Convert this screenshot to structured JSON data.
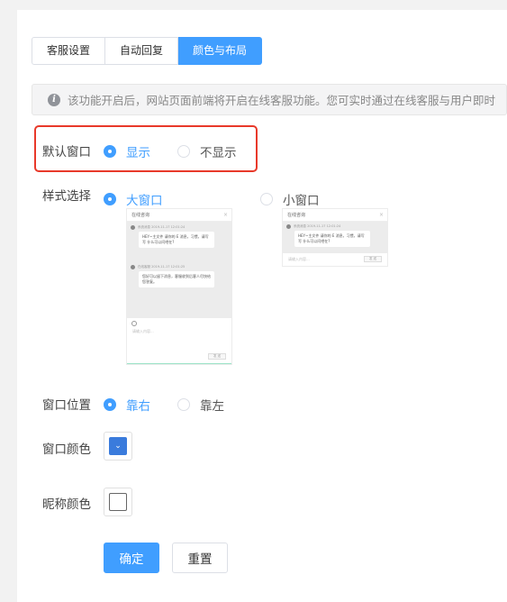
{
  "tabs": [
    {
      "label": "客服设置",
      "active": false
    },
    {
      "label": "自动回复",
      "active": false
    },
    {
      "label": "颜色与布局",
      "active": true
    }
  ],
  "info": {
    "icon": "info-icon",
    "text": "该功能开启后，网站页面前端将开启在线客服功能。您可实时通过在线客服与用户即时"
  },
  "default_window": {
    "label": "默认窗口",
    "options": [
      {
        "label": "显示",
        "checked": true
      },
      {
        "label": "不显示",
        "checked": false
      }
    ]
  },
  "style": {
    "label": "样式选择",
    "options": [
      {
        "label": "大窗口",
        "checked": true
      },
      {
        "label": "小窗口",
        "checked": false
      }
    ],
    "preview": {
      "title": "在线咨询",
      "close": "×",
      "msg1_meta": "系统消息 2019-11-17 12:01:24",
      "msg1_text": "HEY~主文件 请你的 E 消息，习惯，请写写 什么可以问吧在?",
      "msg2_meta": "在线客服 2019-11-17 12:01:25",
      "msg2_text": "您好可以留下消息，客服收到后客人尽快给您答复。",
      "placeholder": "请输入内容...",
      "send": "发 送"
    }
  },
  "position": {
    "label": "窗口位置",
    "options": [
      {
        "label": "靠右",
        "checked": true
      },
      {
        "label": "靠左",
        "checked": false
      }
    ]
  },
  "window_color": {
    "label": "窗口颜色",
    "value": "#3a7bdc"
  },
  "nickname_color": {
    "label": "昵称颜色",
    "value": "#ffffff"
  },
  "buttons": {
    "confirm": "确定",
    "reset": "重置"
  },
  "colors": {
    "accent": "#409eff",
    "highlight": "#e8392a"
  }
}
